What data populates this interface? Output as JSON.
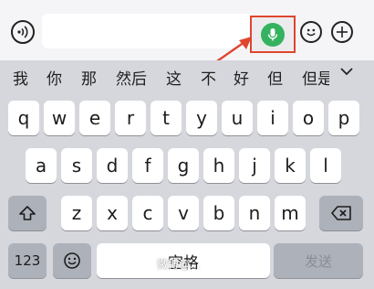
{
  "input": {
    "value": ""
  },
  "candidates": [
    "我",
    "你",
    "那",
    "然后",
    "这",
    "不",
    "好",
    "但",
    "但是"
  ],
  "keyboard": {
    "row1": [
      "q",
      "w",
      "e",
      "r",
      "t",
      "y",
      "u",
      "i",
      "o",
      "p"
    ],
    "row2": [
      "a",
      "s",
      "d",
      "f",
      "g",
      "h",
      "j",
      "k",
      "l"
    ],
    "row3": [
      "z",
      "x",
      "c",
      "v",
      "b",
      "n",
      "m"
    ],
    "numbers_label": "123",
    "space_label": "空格",
    "send_label": "发送"
  },
  "watermark": "微博@...",
  "colors": {
    "highlight": "#e0452e",
    "mic": "#35b25f"
  }
}
